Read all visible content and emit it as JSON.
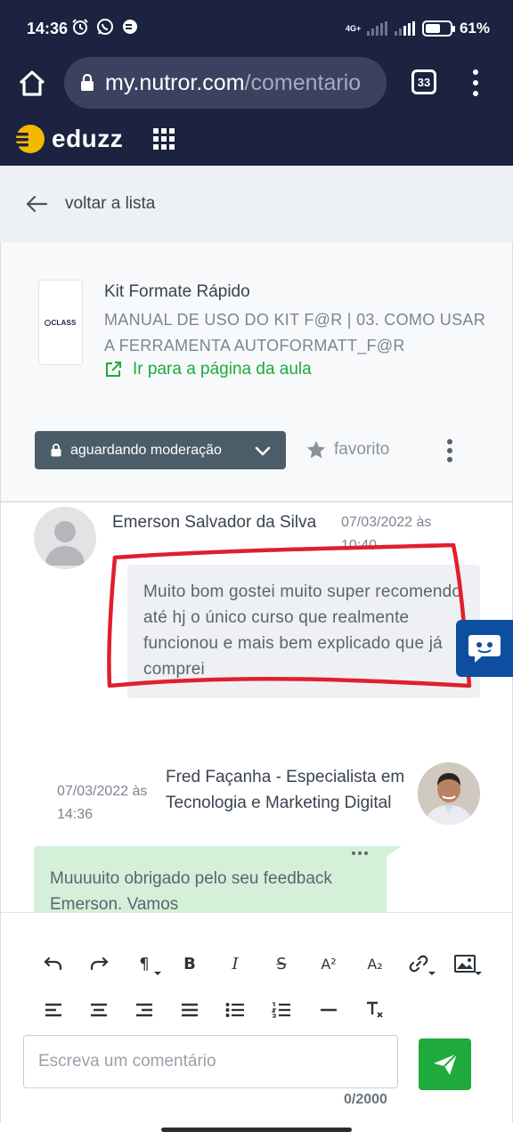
{
  "status_bar": {
    "time": "14:36",
    "network": "4G+",
    "battery": "61%",
    "battery_level": 0.61
  },
  "browser": {
    "url_host": "my.nutror.com",
    "url_path": "/comentario",
    "tab_count": "33"
  },
  "header": {
    "logo_text": "eduzz"
  },
  "nav": {
    "back_label": "voltar a lista"
  },
  "lesson": {
    "thumb_text": "CLASS",
    "course_title": "Kit Formate Rápido",
    "lesson_title": "MANUAL DE USO DO KIT F@R | 03. COMO USAR A FERRAMENTA AUTOFORMATT_F@R",
    "link_label": "Ir para a página da aula",
    "status_label": "aguardando moderação",
    "favorite_label": "favorito"
  },
  "comments": [
    {
      "author": "Emerson Salvador da Silva",
      "date": "07/03/2022 às 10:40",
      "text": "Muito bom gostei muito super recomendo até hj o único curso que realmente funcionou e mais bem explicado que já comprei"
    },
    {
      "author": "Fred Façanha - Especialista em Tecnologia e Marketing Digital",
      "date": "07/03/2022 às 14:36",
      "text": "Muuuuito obrigado pelo seu feedback Emerson. Vamos"
    }
  ],
  "editor": {
    "toolbar_paragraph": "¶",
    "toolbar_bold": "B",
    "toolbar_italic": "I",
    "toolbar_strike": "S",
    "toolbar_superscript": "A²",
    "toolbar_subscript": "A₂",
    "input_placeholder": "Escreva um comentário",
    "counter": "0/2000"
  },
  "colors": {
    "header_bg": "#1b2340",
    "accent_green": "#1eaa3c",
    "status_button": "#4a5d68",
    "chat_widget": "#0d4ea0",
    "highlight_red": "#e01f2d",
    "logo_yellow": "#f5b800"
  }
}
